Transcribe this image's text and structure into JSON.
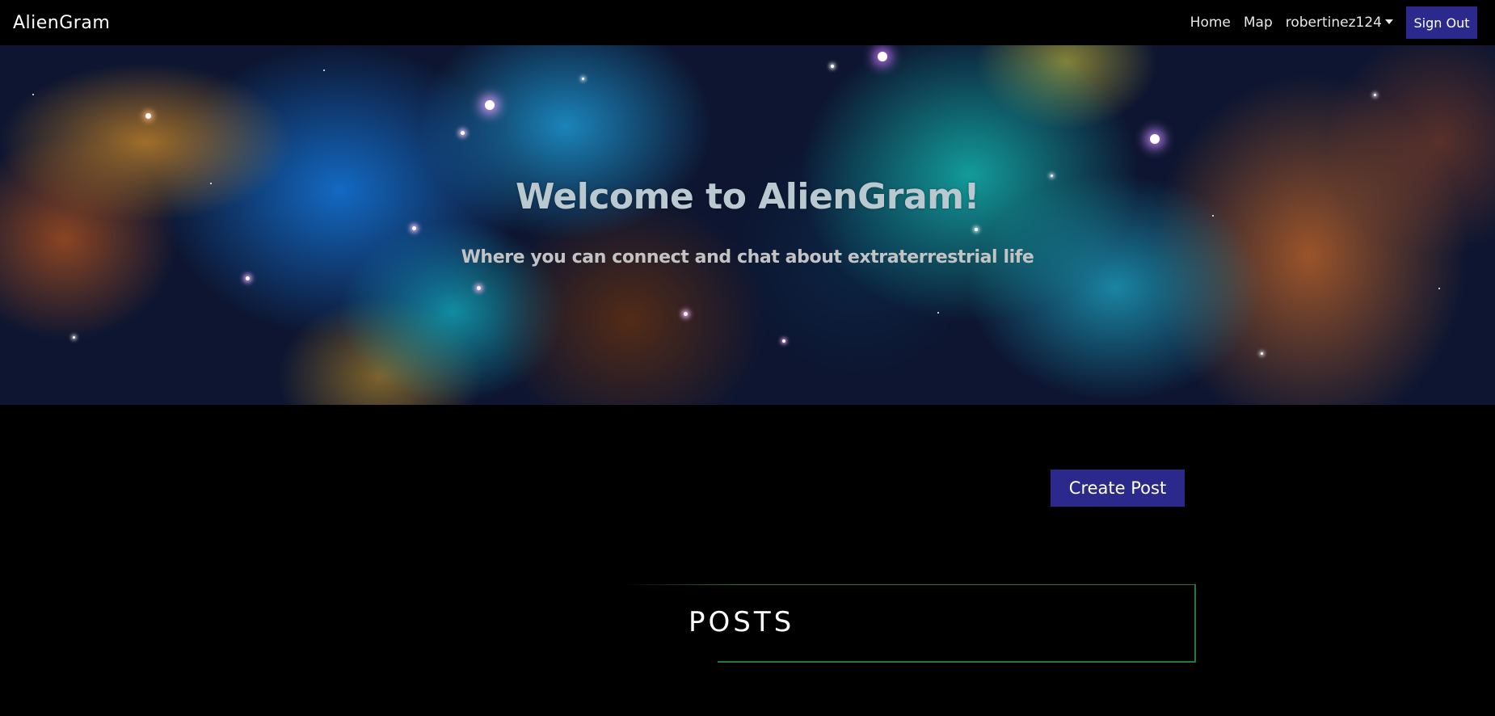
{
  "navbar": {
    "brand": "AlienGram",
    "links": {
      "home": "Home",
      "map": "Map"
    },
    "user": "robertinez124",
    "sign_out": "Sign Out"
  },
  "hero": {
    "title": "Welcome to AlienGram!",
    "subtitle": "Where you can connect and chat about extraterrestrial life"
  },
  "actions": {
    "create_post": "Create Post"
  },
  "posts": {
    "heading": "POSTS"
  },
  "colors": {
    "background": "#000000",
    "button": "#2b2a8c",
    "accent_line": "#1f7a3c"
  },
  "icons": {
    "user_menu": "caret-down-icon"
  }
}
